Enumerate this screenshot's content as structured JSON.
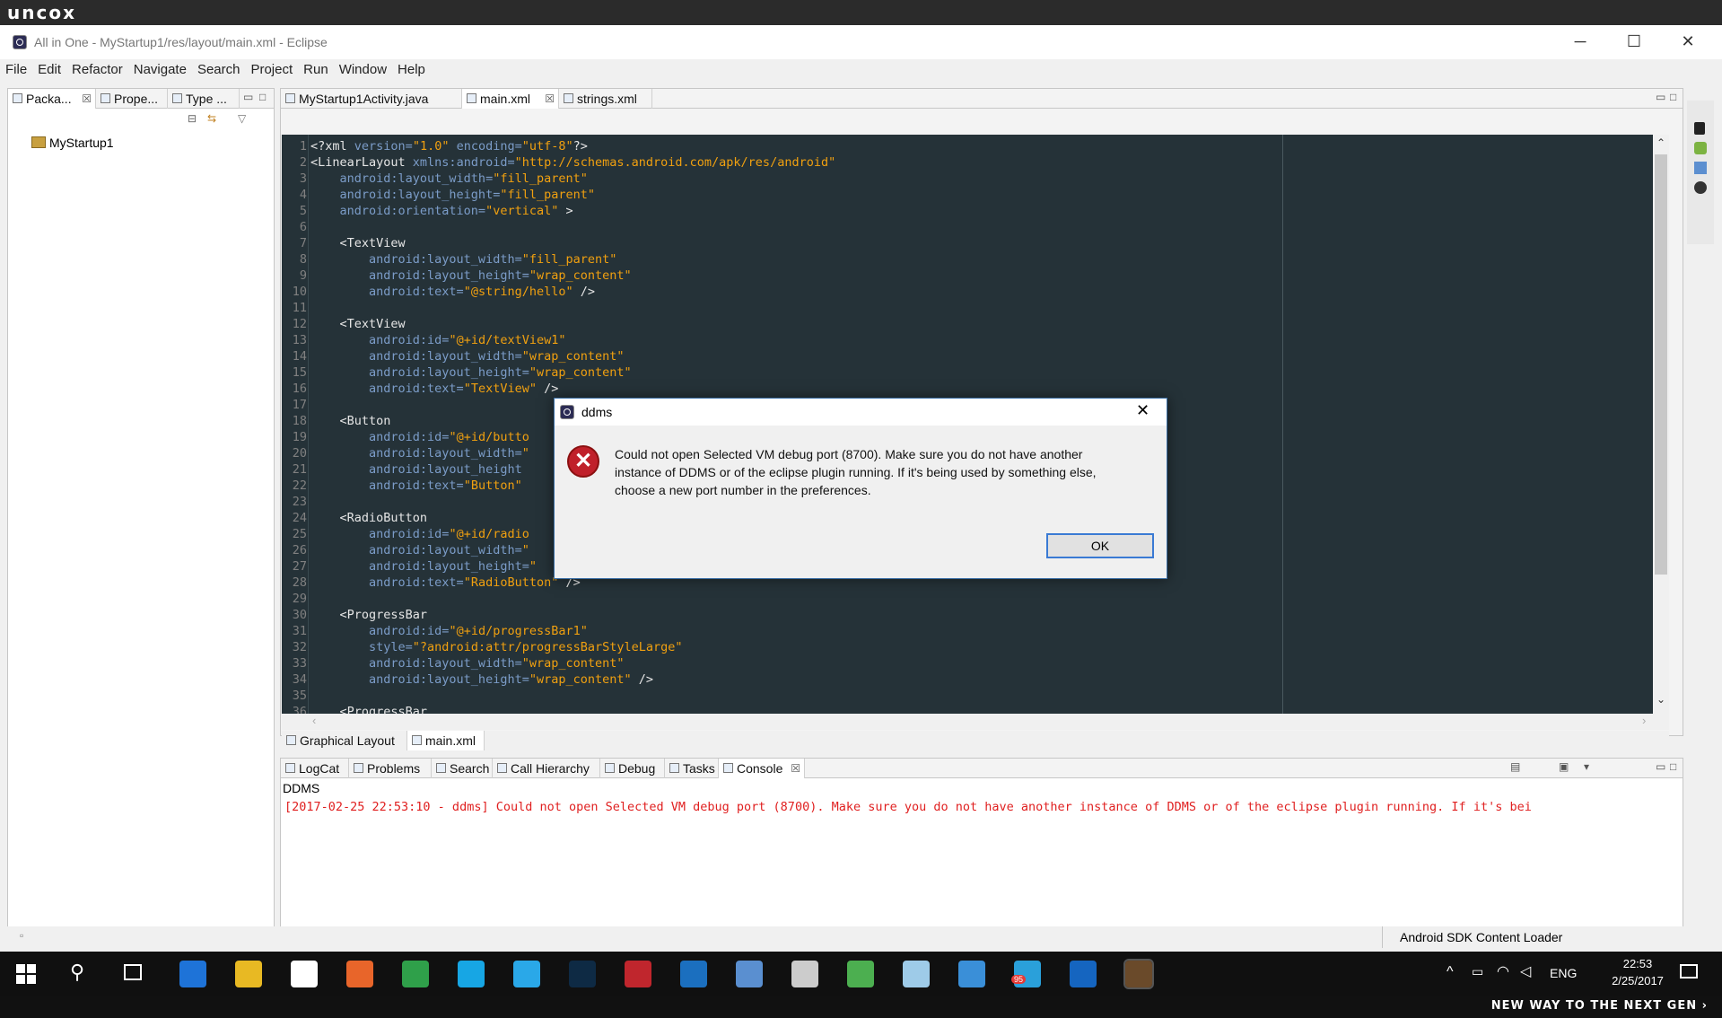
{
  "brand": {
    "text": "uncox",
    "tagline": "NEW WAY TO THE NEXT GEN ›"
  },
  "window": {
    "title": "All in One - MyStartup1/res/layout/main.xml - Eclipse"
  },
  "menu": [
    "File",
    "Edit",
    "Refactor",
    "Navigate",
    "Search",
    "Project",
    "Run",
    "Window",
    "Help"
  ],
  "left_panel": {
    "tabs": [
      "Packa...",
      "Prope...",
      "Type ..."
    ],
    "project": "MyStartup1"
  },
  "editor_tabs": [
    "MyStartup1Activity.java",
    "main.xml",
    "strings.xml"
  ],
  "code": {
    "lines": [
      [
        [
          "<?xml ",
          ""
        ],
        [
          "version=",
          "attr"
        ],
        [
          "\"1.0\" ",
          "val"
        ],
        [
          "encoding=",
          "attr"
        ],
        [
          "\"utf-8\"",
          "val"
        ],
        [
          "?>",
          ""
        ]
      ],
      [
        [
          "<LinearLayout ",
          ""
        ],
        [
          "xmlns:android=",
          "attr"
        ],
        [
          "\"http://schemas.android.com/apk/res/android\"",
          "val"
        ]
      ],
      [
        [
          "    android:layout_width=",
          "attr"
        ],
        [
          "\"fill_parent\"",
          "val"
        ]
      ],
      [
        [
          "    android:layout_height=",
          "attr"
        ],
        [
          "\"fill_parent\"",
          "val"
        ]
      ],
      [
        [
          "    android:orientation=",
          "attr"
        ],
        [
          "\"vertical\"",
          "val"
        ],
        [
          " >",
          ""
        ]
      ],
      [
        [
          "",
          ""
        ]
      ],
      [
        [
          "    <TextView",
          ""
        ]
      ],
      [
        [
          "        android:layout_width=",
          "attr"
        ],
        [
          "\"fill_parent\"",
          "val"
        ]
      ],
      [
        [
          "        android:layout_height=",
          "attr"
        ],
        [
          "\"wrap_content\"",
          "val"
        ]
      ],
      [
        [
          "        android:text=",
          "attr"
        ],
        [
          "\"@string/hello\"",
          "val"
        ],
        [
          " />",
          ""
        ]
      ],
      [
        [
          "",
          ""
        ]
      ],
      [
        [
          "    <TextView",
          ""
        ]
      ],
      [
        [
          "        android:id=",
          "attr"
        ],
        [
          "\"@+id/textView1\"",
          "val"
        ]
      ],
      [
        [
          "        android:layout_width=",
          "attr"
        ],
        [
          "\"wrap_content\"",
          "val"
        ]
      ],
      [
        [
          "        android:layout_height=",
          "attr"
        ],
        [
          "\"wrap_content\"",
          "val"
        ]
      ],
      [
        [
          "        android:text=",
          "attr"
        ],
        [
          "\"TextView\"",
          "val"
        ],
        [
          " />",
          ""
        ]
      ],
      [
        [
          "",
          ""
        ]
      ],
      [
        [
          "    <Button",
          ""
        ]
      ],
      [
        [
          "        android:id=",
          "attr"
        ],
        [
          "\"@+id/butto",
          "val"
        ]
      ],
      [
        [
          "        android:layout_width=",
          "attr"
        ],
        [
          "\"",
          "val"
        ]
      ],
      [
        [
          "        android:layout_height",
          "attr"
        ]
      ],
      [
        [
          "        android:text=",
          "attr"
        ],
        [
          "\"Button\"",
          "val"
        ]
      ],
      [
        [
          "",
          ""
        ]
      ],
      [
        [
          "    <RadioButton",
          ""
        ]
      ],
      [
        [
          "        android:id=",
          "attr"
        ],
        [
          "\"@+id/radio",
          "val"
        ]
      ],
      [
        [
          "        android:layout_width=",
          "attr"
        ],
        [
          "\"",
          "val"
        ]
      ],
      [
        [
          "        android:layout_height=",
          "attr"
        ],
        [
          "\"",
          "val"
        ]
      ],
      [
        [
          "        android:text=",
          "attr"
        ],
        [
          "\"RadioButton\"",
          "val"
        ],
        [
          " />",
          ""
        ]
      ],
      [
        [
          "",
          ""
        ]
      ],
      [
        [
          "    <ProgressBar",
          ""
        ]
      ],
      [
        [
          "        android:id=",
          "attr"
        ],
        [
          "\"@+id/progressBar1\"",
          "val"
        ]
      ],
      [
        [
          "        style=",
          "attr"
        ],
        [
          "\"?android:attr/progressBarStyleLarge\"",
          "val"
        ]
      ],
      [
        [
          "        android:layout_width=",
          "attr"
        ],
        [
          "\"wrap_content\"",
          "val"
        ]
      ],
      [
        [
          "        android:layout_height=",
          "attr"
        ],
        [
          "\"wrap_content\"",
          "val"
        ],
        [
          " />",
          ""
        ]
      ],
      [
        [
          "",
          ""
        ]
      ],
      [
        [
          "    <ProgressBar",
          ""
        ]
      ]
    ]
  },
  "editor_bottom_tabs": [
    "Graphical Layout",
    "main.xml"
  ],
  "console_tabs": [
    "LogCat",
    "Problems",
    "Search",
    "Call Hierarchy",
    "Debug",
    "Tasks",
    "Console"
  ],
  "console": {
    "name": "DDMS",
    "line": "[2017-02-25 22:53:10 - ddms] Could not open Selected VM debug port (8700). Make sure you do not have another instance of DDMS or of the eclipse plugin running. If it's bei"
  },
  "status": {
    "right": "Android SDK Content Loader"
  },
  "dialog": {
    "title": "ddms",
    "message_lines": [
      "Could not open Selected VM debug port (8700). Make sure you do not have another",
      "instance of DDMS or of the eclipse plugin running. If it's being used by something else,",
      "choose a new port number in the preferences."
    ],
    "ok": "OK"
  },
  "taskbar": {
    "lang": "ENG",
    "time": "22:53",
    "date": "2/25/2017",
    "badge": "95",
    "apps": [
      {
        "icon": "edge-icon",
        "color": "#1e73d8"
      },
      {
        "icon": "file-explorer-icon",
        "color": "#e8b923"
      },
      {
        "icon": "store-icon",
        "color": "#ffffff"
      },
      {
        "icon": "firefox-icon",
        "color": "#e8652a"
      },
      {
        "icon": "network-globe-icon",
        "color": "#2fa04a"
      },
      {
        "icon": "skype-icon",
        "color": "#17a6e4"
      },
      {
        "icon": "sync-icon",
        "color": "#2aa8e8"
      },
      {
        "icon": "photoshop-icon",
        "color": "#0e2a44"
      },
      {
        "icon": "antivirus-icon",
        "color": "#c0262d"
      },
      {
        "icon": "ccleaner-icon",
        "color": "#1b6fbf"
      },
      {
        "icon": "browser-icon",
        "color": "#5a8fd0"
      },
      {
        "icon": "tool-icon",
        "color": "#cccccc"
      },
      {
        "icon": "chrome-icon",
        "color": "#4caf50"
      },
      {
        "icon": "notepad-icon",
        "color": "#9ecbe8"
      },
      {
        "icon": "contacts-icon",
        "color": "#3a8fd8"
      },
      {
        "icon": "telegram-icon",
        "color": "#2aa0da"
      },
      {
        "icon": "window-app-icon",
        "color": "#1565c0"
      },
      {
        "icon": "eclipse-icon",
        "color": "#6a4a2a"
      }
    ]
  }
}
